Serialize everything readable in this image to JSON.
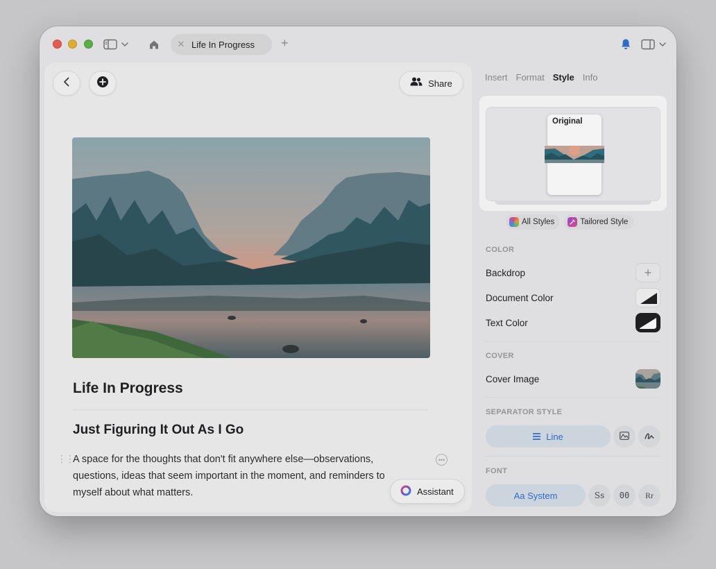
{
  "window": {
    "tab_title": "Life In Progress"
  },
  "editor": {
    "share_label": "Share",
    "doc_title": "Life In Progress",
    "heading": "Just Figuring It Out As I Go",
    "body_line1": "A space for the thoughts that don't fit anywhere else—observations,",
    "body_line2": "questions, ideas that seem important in the moment, and reminders to",
    "body_line3": "myself about what matters.",
    "assistant_label": "Assistant"
  },
  "inspector": {
    "tabs": [
      "Insert",
      "Format",
      "Style",
      "Info"
    ],
    "active_tab": "Style",
    "preview_label": "Original",
    "chip_all_styles": "All Styles",
    "chip_tailored": "Tailored Style",
    "color_section": "COLOR",
    "backdrop": "Backdrop",
    "document_color": "Document Color",
    "text_color": "Text Color",
    "cover_section": "COVER",
    "cover_image": "Cover Image",
    "separator_section": "SEPARATOR STYLE",
    "separator_line": "Line",
    "font_section": "FONT",
    "font_system": "Aa System",
    "font_opt1": "Ss",
    "font_opt2": "00",
    "font_opt3": "Rr"
  },
  "colors": {
    "accent": "#2f6fd0",
    "traffic_red": "#ee5d55",
    "traffic_yellow": "#e7b431",
    "traffic_green": "#5cb545"
  },
  "icons": [
    "sidebar-icon",
    "chevron-down-icon",
    "home-icon",
    "close-icon",
    "plus-icon",
    "bell-icon",
    "panel-icon",
    "back-chevron-icon",
    "add-circle-icon",
    "people-icon",
    "more-icon",
    "drag-handle-icon",
    "assistant-ring-icon",
    "line-icon",
    "image-pattern-icon",
    "signature-icon"
  ]
}
